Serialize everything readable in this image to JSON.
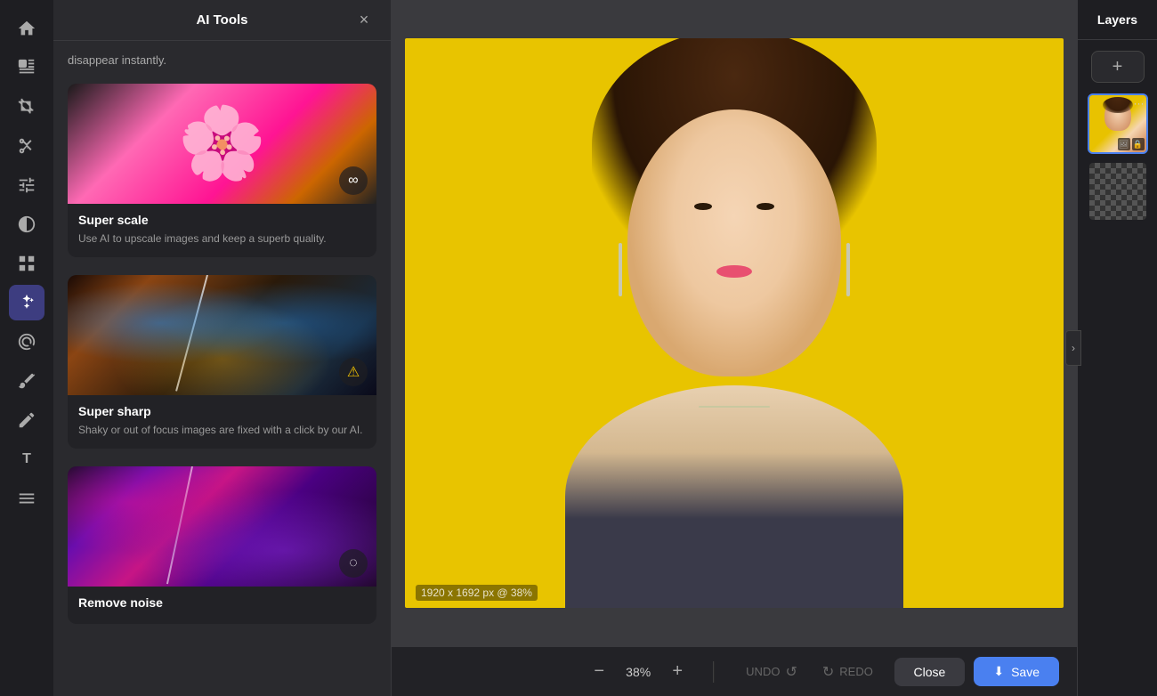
{
  "app": {
    "title": "AI Tools"
  },
  "left_toolbar": {
    "icons": [
      {
        "name": "home-icon",
        "symbol": "⌂",
        "active": false
      },
      {
        "name": "selection-icon",
        "symbol": "⬚",
        "active": false
      },
      {
        "name": "crop-icon",
        "symbol": "⛶",
        "active": false
      },
      {
        "name": "cut-icon",
        "symbol": "✂",
        "active": false
      },
      {
        "name": "adjustments-icon",
        "symbol": "⊞",
        "active": false
      },
      {
        "name": "contrast-icon",
        "symbol": "◑",
        "active": false
      },
      {
        "name": "grid-icon",
        "symbol": "⊞",
        "active": false
      },
      {
        "name": "ai-tools-icon",
        "symbol": "✦",
        "active": true
      },
      {
        "name": "spiral-icon",
        "symbol": "◎",
        "active": false
      },
      {
        "name": "brush-icon",
        "symbol": "✏",
        "active": false
      },
      {
        "name": "pen-icon",
        "symbol": "✒",
        "active": false
      },
      {
        "name": "text-icon",
        "symbol": "T",
        "active": false
      },
      {
        "name": "lines-icon",
        "symbol": "≡",
        "active": false
      }
    ]
  },
  "ai_panel": {
    "title": "AI Tools",
    "close_label": "×",
    "scroll_text": "disappear instantly.",
    "tools": [
      {
        "name": "Super scale",
        "description": "Use AI to upscale images and keep a superb quality.",
        "badge_type": "link",
        "badge_symbol": "∞"
      },
      {
        "name": "Super sharp",
        "description": "Shaky or out of focus images are fixed with a click by our AI.",
        "badge_type": "warning",
        "badge_symbol": "⚠"
      },
      {
        "name": "Remove noise",
        "description": "",
        "badge_type": "loading",
        "badge_symbol": "◌"
      }
    ]
  },
  "canvas": {
    "image_info": "1920 x 1692 px @ 38%",
    "zoom_value": "38%"
  },
  "bottom_toolbar": {
    "zoom_minus": "−",
    "zoom_plus": "+",
    "zoom_value": "38%",
    "undo_label": "UNDO",
    "redo_label": "REDO",
    "close_label": "Close",
    "save_label": "Save"
  },
  "layers_panel": {
    "title": "Layers",
    "add_button": "+",
    "layers": [
      {
        "name": "portrait-layer",
        "type": "portrait"
      },
      {
        "name": "transparent-layer",
        "type": "transparent"
      }
    ]
  },
  "colors": {
    "accent": "#4a80f0",
    "active_tool": "#3d3d80",
    "panel_bg": "#2a2a2e",
    "toolbar_bg": "#1e1e22"
  }
}
